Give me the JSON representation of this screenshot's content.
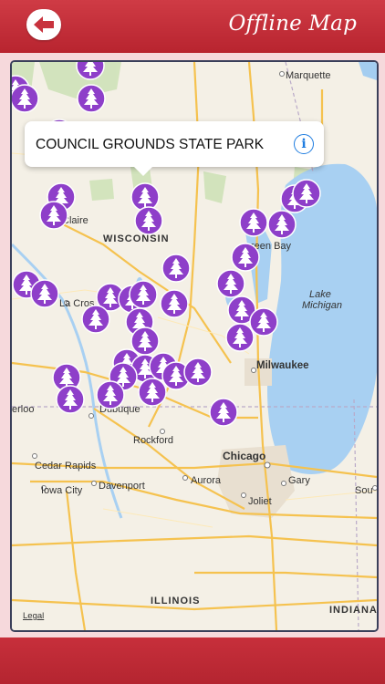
{
  "header": {
    "title": "Offline Map",
    "back_icon": "back-arrow-icon"
  },
  "callout": {
    "title": "COUNCIL GROUNDS STATE PARK",
    "info_icon": "info-icon"
  },
  "map": {
    "legal": "Legal",
    "places": {
      "marquette": "Marquette",
      "wisconsin": "WISCONSIN",
      "green_bay": "reen Bay",
      "lake_michigan_1": "Lake",
      "lake_michigan_2": "Michigan",
      "claire": "Claire",
      "la_crosse": "La Cros",
      "milwaukee": "Milwaukee",
      "erloo": "erloo",
      "dubuque": "Dubuque",
      "rockford": "Rockford",
      "cedar_rapids": "Cedar Rapids",
      "iowa_city": "Iowa City",
      "davenport": "Davenport",
      "chicago": "Chicago",
      "aurora": "Aurora",
      "gary": "Gary",
      "joliet": "Joliet",
      "sou": "Sou",
      "illinois": "ILLINOIS",
      "indiana": "INDIANA"
    },
    "pin_icon": "tree-pin-icon",
    "pin_color": "#8e3fc9"
  }
}
